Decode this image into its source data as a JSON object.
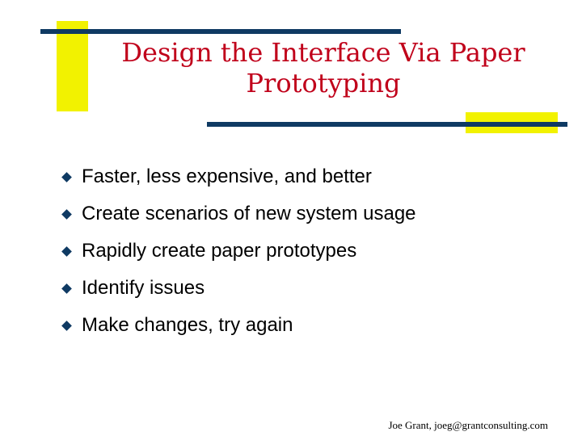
{
  "slide": {
    "title_line1": "Design the Interface Via Paper",
    "title_line2": "Prototyping",
    "bullets": [
      "Faster, less expensive, and better",
      "Create scenarios of new system usage",
      "Rapidly create paper prototypes",
      "Identify issues",
      "Make changes, try again"
    ],
    "footer": "Joe Grant, joeg@grantconsulting.com"
  },
  "colors": {
    "title": "#c0001a",
    "accent_blue": "#0f3a63",
    "accent_yellow": "#f2f200"
  },
  "icons": {
    "bullet": "diamond-bullet-icon"
  }
}
